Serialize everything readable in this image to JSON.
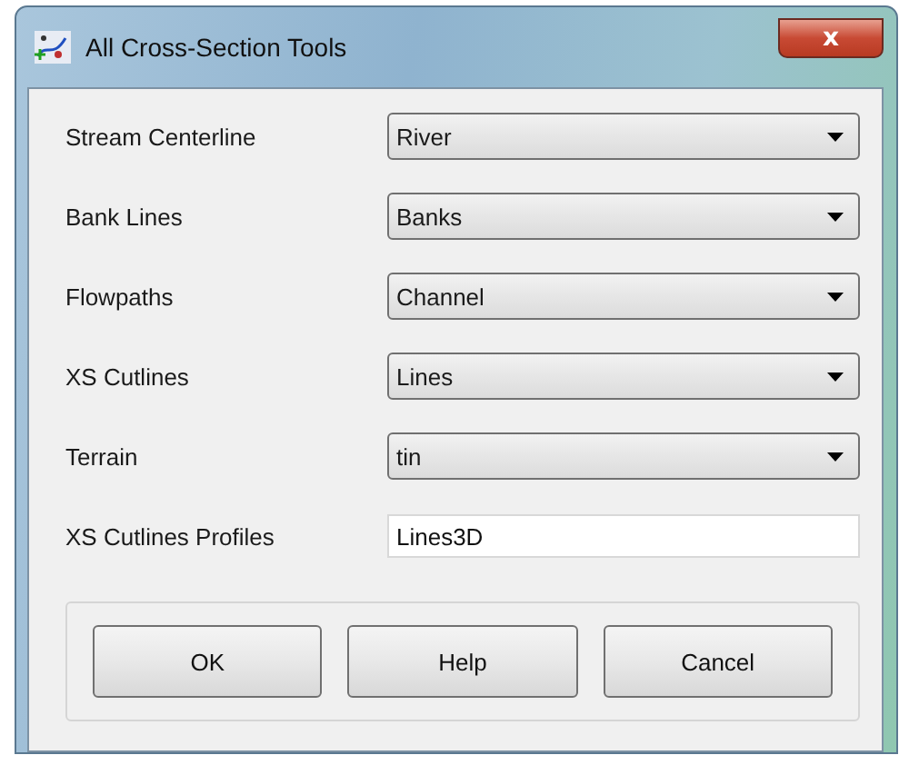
{
  "window": {
    "title": "All Cross-Section Tools",
    "close": "x"
  },
  "fields": [
    {
      "label": "Stream Centerline",
      "kind": "dropdown",
      "value": "River"
    },
    {
      "label": "Bank Lines",
      "kind": "dropdown",
      "value": "Banks"
    },
    {
      "label": "Flowpaths",
      "kind": "dropdown",
      "value": "Channel"
    },
    {
      "label": "XS Cutlines",
      "kind": "dropdown",
      "value": "Lines"
    },
    {
      "label": "Terrain",
      "kind": "dropdown",
      "value": "tin"
    },
    {
      "label": "XS Cutlines Profiles",
      "kind": "text",
      "value": "Lines3D"
    }
  ],
  "buttons": [
    "OK",
    "Help",
    "Cancel"
  ]
}
